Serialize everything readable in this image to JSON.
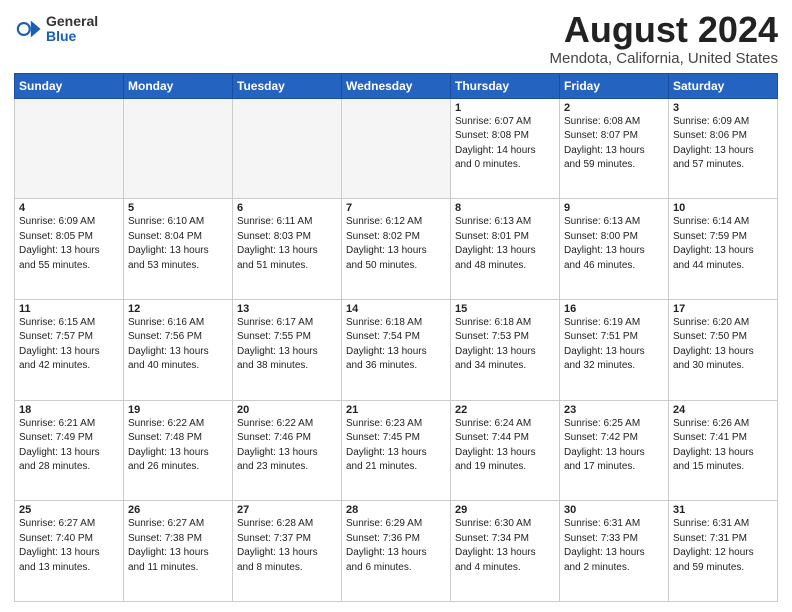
{
  "logo": {
    "general": "General",
    "blue": "Blue"
  },
  "header": {
    "title": "August 2024",
    "subtitle": "Mendota, California, United States"
  },
  "weekdays": [
    "Sunday",
    "Monday",
    "Tuesday",
    "Wednesday",
    "Thursday",
    "Friday",
    "Saturday"
  ],
  "weeks": [
    [
      {
        "day": "",
        "empty": true
      },
      {
        "day": "",
        "empty": true
      },
      {
        "day": "",
        "empty": true
      },
      {
        "day": "",
        "empty": true
      },
      {
        "day": "1",
        "sunrise": "6:07 AM",
        "sunset": "8:08 PM",
        "daylight": "14 hours and 0 minutes."
      },
      {
        "day": "2",
        "sunrise": "6:08 AM",
        "sunset": "8:07 PM",
        "daylight": "13 hours and 59 minutes."
      },
      {
        "day": "3",
        "sunrise": "6:09 AM",
        "sunset": "8:06 PM",
        "daylight": "13 hours and 57 minutes."
      }
    ],
    [
      {
        "day": "4",
        "sunrise": "6:09 AM",
        "sunset": "8:05 PM",
        "daylight": "13 hours and 55 minutes."
      },
      {
        "day": "5",
        "sunrise": "6:10 AM",
        "sunset": "8:04 PM",
        "daylight": "13 hours and 53 minutes."
      },
      {
        "day": "6",
        "sunrise": "6:11 AM",
        "sunset": "8:03 PM",
        "daylight": "13 hours and 51 minutes."
      },
      {
        "day": "7",
        "sunrise": "6:12 AM",
        "sunset": "8:02 PM",
        "daylight": "13 hours and 50 minutes."
      },
      {
        "day": "8",
        "sunrise": "6:13 AM",
        "sunset": "8:01 PM",
        "daylight": "13 hours and 48 minutes."
      },
      {
        "day": "9",
        "sunrise": "6:13 AM",
        "sunset": "8:00 PM",
        "daylight": "13 hours and 46 minutes."
      },
      {
        "day": "10",
        "sunrise": "6:14 AM",
        "sunset": "7:59 PM",
        "daylight": "13 hours and 44 minutes."
      }
    ],
    [
      {
        "day": "11",
        "sunrise": "6:15 AM",
        "sunset": "7:57 PM",
        "daylight": "13 hours and 42 minutes."
      },
      {
        "day": "12",
        "sunrise": "6:16 AM",
        "sunset": "7:56 PM",
        "daylight": "13 hours and 40 minutes."
      },
      {
        "day": "13",
        "sunrise": "6:17 AM",
        "sunset": "7:55 PM",
        "daylight": "13 hours and 38 minutes."
      },
      {
        "day": "14",
        "sunrise": "6:18 AM",
        "sunset": "7:54 PM",
        "daylight": "13 hours and 36 minutes."
      },
      {
        "day": "15",
        "sunrise": "6:18 AM",
        "sunset": "7:53 PM",
        "daylight": "13 hours and 34 minutes."
      },
      {
        "day": "16",
        "sunrise": "6:19 AM",
        "sunset": "7:51 PM",
        "daylight": "13 hours and 32 minutes."
      },
      {
        "day": "17",
        "sunrise": "6:20 AM",
        "sunset": "7:50 PM",
        "daylight": "13 hours and 30 minutes."
      }
    ],
    [
      {
        "day": "18",
        "sunrise": "6:21 AM",
        "sunset": "7:49 PM",
        "daylight": "13 hours and 28 minutes."
      },
      {
        "day": "19",
        "sunrise": "6:22 AM",
        "sunset": "7:48 PM",
        "daylight": "13 hours and 26 minutes."
      },
      {
        "day": "20",
        "sunrise": "6:22 AM",
        "sunset": "7:46 PM",
        "daylight": "13 hours and 23 minutes."
      },
      {
        "day": "21",
        "sunrise": "6:23 AM",
        "sunset": "7:45 PM",
        "daylight": "13 hours and 21 minutes."
      },
      {
        "day": "22",
        "sunrise": "6:24 AM",
        "sunset": "7:44 PM",
        "daylight": "13 hours and 19 minutes."
      },
      {
        "day": "23",
        "sunrise": "6:25 AM",
        "sunset": "7:42 PM",
        "daylight": "13 hours and 17 minutes."
      },
      {
        "day": "24",
        "sunrise": "6:26 AM",
        "sunset": "7:41 PM",
        "daylight": "13 hours and 15 minutes."
      }
    ],
    [
      {
        "day": "25",
        "sunrise": "6:27 AM",
        "sunset": "7:40 PM",
        "daylight": "13 hours and 13 minutes."
      },
      {
        "day": "26",
        "sunrise": "6:27 AM",
        "sunset": "7:38 PM",
        "daylight": "13 hours and 11 minutes."
      },
      {
        "day": "27",
        "sunrise": "6:28 AM",
        "sunset": "7:37 PM",
        "daylight": "13 hours and 8 minutes."
      },
      {
        "day": "28",
        "sunrise": "6:29 AM",
        "sunset": "7:36 PM",
        "daylight": "13 hours and 6 minutes."
      },
      {
        "day": "29",
        "sunrise": "6:30 AM",
        "sunset": "7:34 PM",
        "daylight": "13 hours and 4 minutes."
      },
      {
        "day": "30",
        "sunrise": "6:31 AM",
        "sunset": "7:33 PM",
        "daylight": "13 hours and 2 minutes."
      },
      {
        "day": "31",
        "sunrise": "6:31 AM",
        "sunset": "7:31 PM",
        "daylight": "12 hours and 59 minutes."
      }
    ]
  ]
}
